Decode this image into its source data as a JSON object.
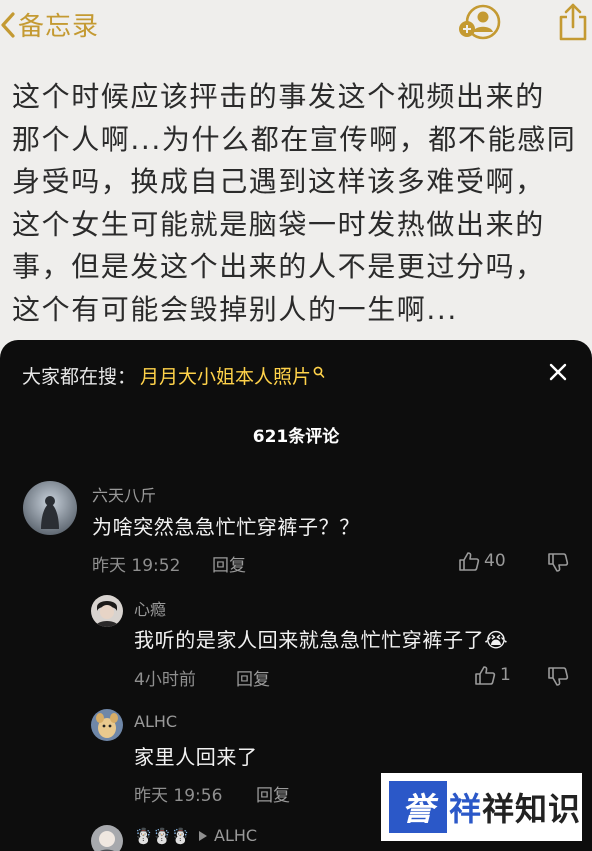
{
  "notes": {
    "back_label": "备忘录",
    "body_lines": [
      "这个时候应该抨击的事发这个视频出来的",
      "那个人啊...为什么都在宣传啊，都不能感同",
      "身受吗，换成自己遇到这样该多难受啊，",
      "这个女生可能就是脑袋一时发热做出来的",
      "事，但是发这个出来的人不是更过分吗，",
      "这个有可能会毁掉别人的一生啊..."
    ],
    "accent_color": "#c49a32"
  },
  "comments_panel": {
    "search_prefix": "大家都在搜：",
    "search_term": "月月大小姐本人照片",
    "title": "621条评论",
    "highlight_color": "#ffd24a",
    "comments": [
      {
        "username": "六天八斤",
        "text": "为啥突然急急忙忙穿裤子？？",
        "time": "昨天 19:52",
        "reply_label": "回复",
        "likes": "40"
      },
      {
        "username": "心瘾",
        "text": "我听的是家人回来就急急忙忙穿裤子了",
        "emoji": "😭",
        "time": "4小时前",
        "reply_label": "回复",
        "likes": "1"
      },
      {
        "username": "ALHC",
        "text": "家里人回来了",
        "time": "昨天 19:56",
        "reply_label": "回复"
      },
      {
        "username": "☃️☃️☃️",
        "reply_to": "ALHC"
      }
    ]
  },
  "watermark": {
    "logo_text": "誉",
    "text_blue": "祥",
    "text_rest": "祥知识"
  }
}
